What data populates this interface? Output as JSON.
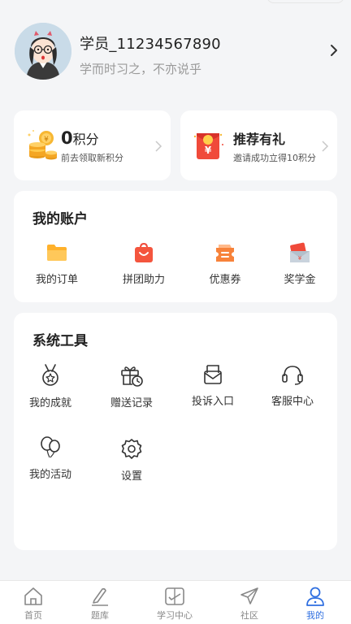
{
  "profile": {
    "username": "学员_11234567890",
    "motto": "学而时习之，不亦说乎"
  },
  "points": {
    "value": "0",
    "unit": "积分",
    "subtitle": "前去领取新积分"
  },
  "invite": {
    "title": "推荐有礼",
    "subtitle": "邀请成功立得10积分"
  },
  "account": {
    "title": "我的账户",
    "items": [
      {
        "label": "我的订单",
        "icon": "folder-icon"
      },
      {
        "label": "拼团助力",
        "icon": "shopping-bag-icon"
      },
      {
        "label": "优惠券",
        "icon": "coupon-icon"
      },
      {
        "label": "奖学金",
        "icon": "scholarship-icon"
      }
    ]
  },
  "tools": {
    "title": "系统工具",
    "items": [
      {
        "label": "我的成就",
        "icon": "medal-icon"
      },
      {
        "label": "赠送记录",
        "icon": "gift-clock-icon"
      },
      {
        "label": "投诉入口",
        "icon": "mail-icon"
      },
      {
        "label": "客服中心",
        "icon": "headset-icon"
      },
      {
        "label": "我的活动",
        "icon": "balloon-icon"
      },
      {
        "label": "设置",
        "icon": "gear-icon"
      }
    ]
  },
  "tabs": [
    {
      "label": "首页",
      "icon": "home-icon"
    },
    {
      "label": "题库",
      "icon": "pen-icon"
    },
    {
      "label": "学习中心",
      "icon": "study-center-icon"
    },
    {
      "label": "社区",
      "icon": "paper-plane-icon"
    },
    {
      "label": "我的",
      "icon": "user-icon",
      "active": true
    }
  ],
  "colors": {
    "accent": "#2f6fe0",
    "orange": "#f5a623",
    "red": "#f04a3a",
    "background": "#f4f5f7"
  }
}
